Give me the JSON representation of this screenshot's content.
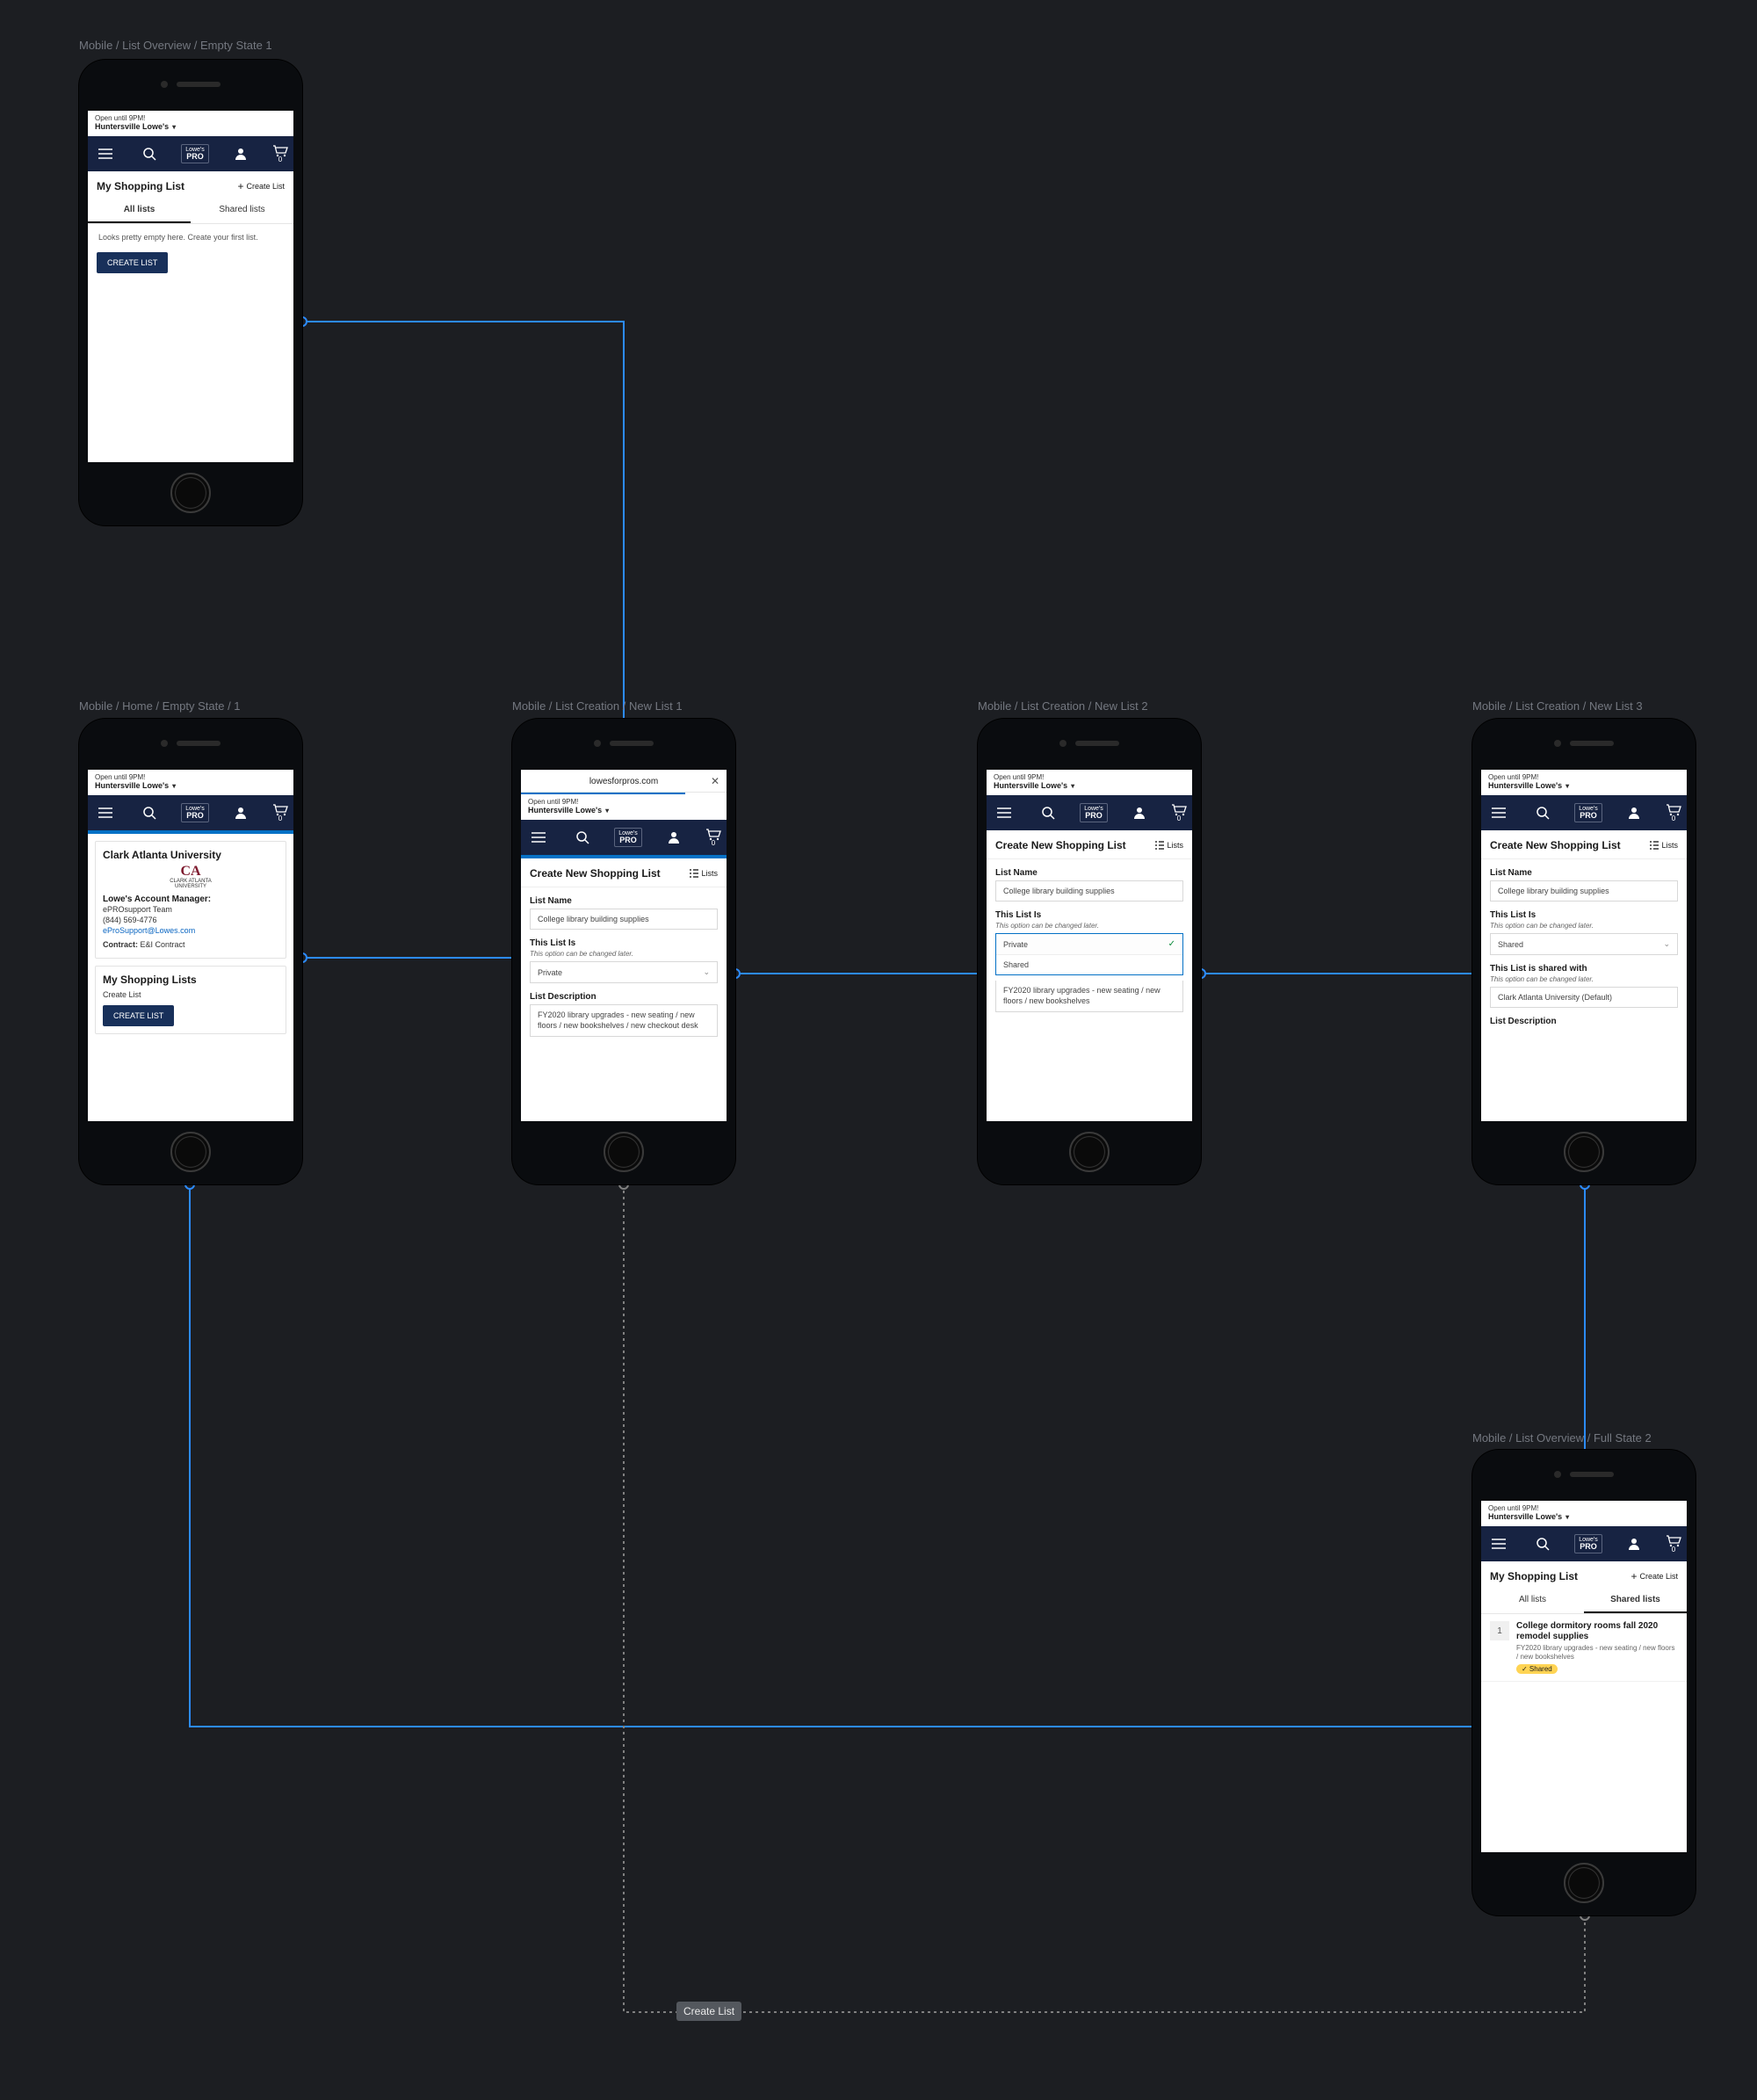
{
  "labels": {
    "f1": "Mobile / List Overview / Empty State 1",
    "f2": "Mobile / Home / Empty State / 1",
    "f3": "Mobile / List Creation / New List 1",
    "f4": "Mobile / List Creation / New List 2",
    "f5": "Mobile / List Creation / New List 3",
    "f6": "Mobile / List Overview / Full State 2"
  },
  "store": {
    "hours": "Open until 9PM!",
    "name": "Huntersville Lowe's"
  },
  "url_bar": {
    "text": "lowesforpros.com"
  },
  "nav": {
    "logo_top": "Lowe's",
    "logo_bottom": "PRO",
    "cart_count": "0"
  },
  "overview_empty": {
    "title": "My Shopping List",
    "create_link": "Create List",
    "tab_all": "All lists",
    "tab_shared": "Shared lists",
    "empty_text": "Looks pretty empty here. Create your first list.",
    "cta": "CREATE LIST"
  },
  "home": {
    "org": "Clark Atlanta University",
    "uni_mark": "CA",
    "uni_mark_sub": "CLARK ATLANTA\nUNIVERSITY",
    "mgr_head": "Lowe's Account Manager:",
    "team": "ePROsupport Team",
    "phone": "(844) 569-4776",
    "email": "eProSupport@Lowes.com",
    "contract_label": "Contract:",
    "contract_value": "E&I Contract",
    "lists_head": "My Shopping Lists",
    "create_list_text": "Create List",
    "cta": "CREATE LIST"
  },
  "form": {
    "title": "Create New Shopping List",
    "lists_link": "Lists",
    "name_label": "List Name",
    "name_value": "College library building supplies",
    "vis_label": "This List Is",
    "vis_hint": "This option can be changed later.",
    "vis_private": "Private",
    "vis_shared": "Shared",
    "desc_label": "List Description",
    "desc_value": "FY2020 library upgrades - new seating / new floors / new bookshelves / new checkout desk",
    "desc_value_short": "FY2020 library upgrades - new seating / new floors / new bookshelves",
    "shared_with_label": "This List is shared with",
    "shared_hint": "This option can be changed later.",
    "shared_with_value": "Clark Atlanta University (Default)"
  },
  "overview_full": {
    "title": "My Shopping List",
    "create_link": "Create List",
    "tab_all": "All lists",
    "tab_shared": "Shared lists",
    "item_count": "1",
    "item_title": "College dormitory rooms fall 2020 remodel supplies",
    "item_sub": "FY2020 library upgrades - new seating / new floors / new bookshelves",
    "badge": "✓ Shared"
  },
  "flow_tag": "Create List"
}
